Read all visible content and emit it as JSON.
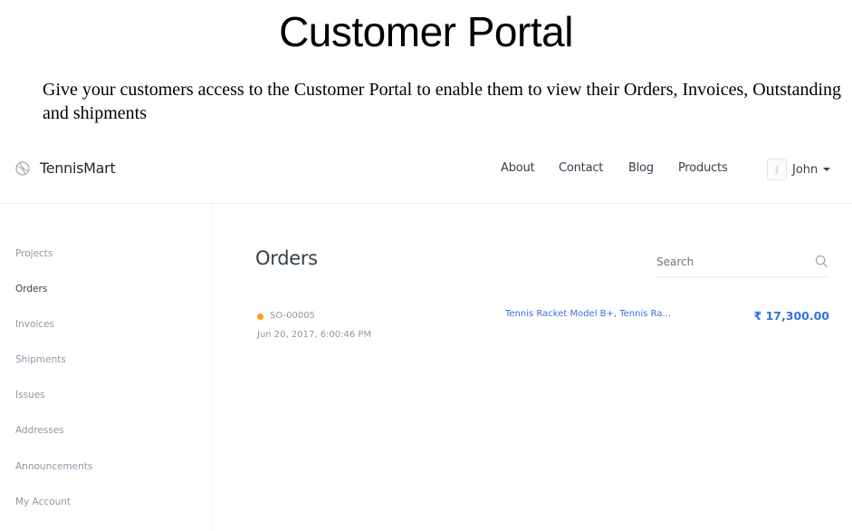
{
  "slide": {
    "title": "Customer Portal",
    "description": "Give your customers access to the Customer Portal to enable them to view their Orders, Invoices, Outstanding  and shipments"
  },
  "navbar": {
    "brand": "TennisMart",
    "brand_icon": "tennis-ball-icon",
    "links": [
      "About",
      "Contact",
      "Blog",
      "Products"
    ],
    "user": {
      "initial": "J",
      "name": "John"
    }
  },
  "sidebar": {
    "items": [
      {
        "label": "Projects",
        "active": false
      },
      {
        "label": "Orders",
        "active": true
      },
      {
        "label": "Invoices",
        "active": false
      },
      {
        "label": "Shipments",
        "active": false
      },
      {
        "label": "Issues",
        "active": false
      },
      {
        "label": "Addresses",
        "active": false
      },
      {
        "label": "Announcements",
        "active": false
      },
      {
        "label": "My Account",
        "active": false
      }
    ]
  },
  "main": {
    "title": "Orders",
    "search": {
      "placeholder": "Search",
      "value": ""
    },
    "orders": [
      {
        "id": "SO-00005",
        "status_color": "#ffa00a",
        "date": "Jun 20, 2017, 6:00:46 PM",
        "items": "Tennis Racket Model B+, Tennis Ra...",
        "amount": "₹ 17,300.00"
      }
    ]
  },
  "colors": {
    "accent": "#2e73e6",
    "muted_text": "#8d99a6",
    "dark_text": "#36414c"
  }
}
